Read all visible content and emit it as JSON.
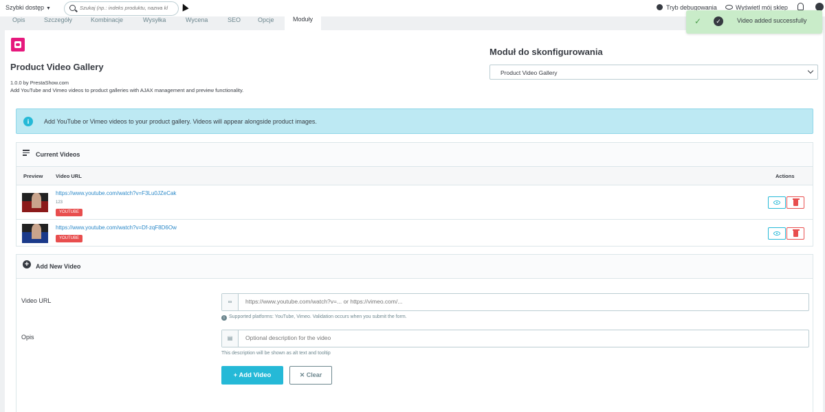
{
  "topbar": {
    "quick_access": "Szybki dostęp",
    "search_placeholder": "Szukaj (np.: indeks produktu, nazwa kl",
    "debug_mode": "Tryb debugowania",
    "view_shop": "Wyświetl mój sklep"
  },
  "tabs": [
    "Opis",
    "Szczegóły",
    "Kombinacje",
    "Wysyłka",
    "Wycena",
    "SEO",
    "Opcje",
    "Moduły"
  ],
  "toast": {
    "message": "Video added successfully"
  },
  "module": {
    "title": "Product Video Gallery",
    "version": "1.0.0 by PrestaShow.com",
    "description": "Add YouTube and Vimeo videos to product galleries with AJAX management and preview functionality."
  },
  "configure": {
    "label": "Moduł do skonfigurowania",
    "selected": "Product Video Gallery"
  },
  "alert": {
    "text": "Add YouTube or Vimeo videos to your product gallery. Videos will appear alongside product images."
  },
  "current_videos": {
    "title": "Current Videos",
    "columns": {
      "preview": "Preview",
      "url": "Video URL",
      "actions": "Actions"
    },
    "rows": [
      {
        "url": "https://www.youtube.com/watch?v=F3Lu0JZeCak",
        "note": "123",
        "badge": "YOUTUBE"
      },
      {
        "url": "https://www.youtube.com/watch?v=Df-zqF8D6Ow",
        "badge": "YOUTUBE"
      }
    ]
  },
  "add_video": {
    "title": "Add New Video",
    "url_label": "Video URL",
    "url_placeholder": "https://www.youtube.com/watch?v=... or https://vimeo.com/...",
    "url_help": "Supported platforms: YouTube, Vimeo. Validation occurs when you submit the form.",
    "desc_label": "Opis",
    "desc_placeholder": "Optional description for the video",
    "desc_help": "This description will be shown as alt text and tooltip",
    "add_button": "Add Video",
    "clear_button": "Clear"
  }
}
